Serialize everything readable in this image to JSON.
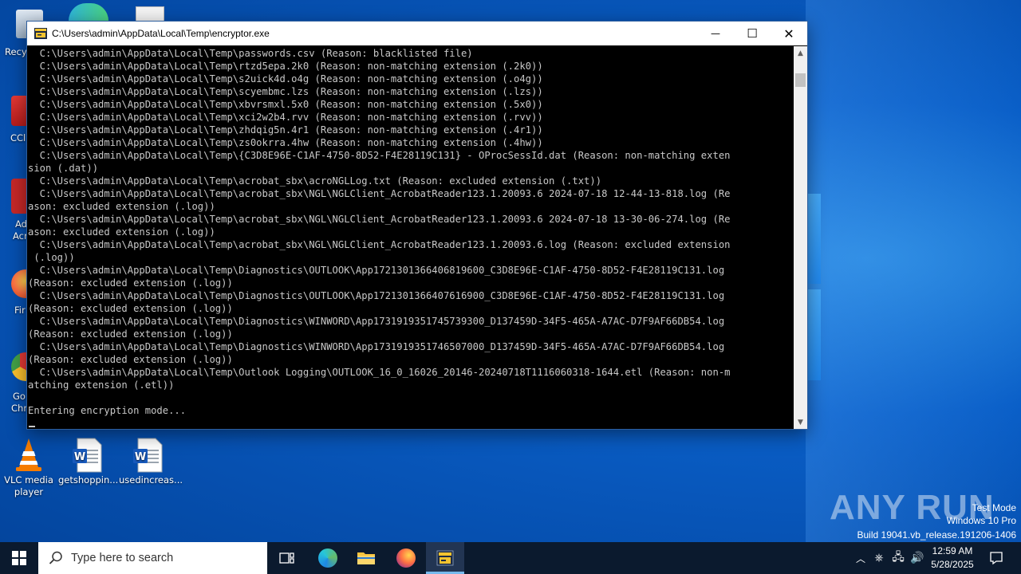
{
  "window": {
    "title": "C:\\Users\\admin\\AppData\\Local\\Temp\\encryptor.exe",
    "controls": {
      "minimize": "—",
      "maximize": "☐",
      "close": "✕"
    }
  },
  "console": {
    "lines": [
      "  C:\\Users\\admin\\AppData\\Local\\Temp\\passwords.csv (Reason: blacklisted file)",
      "  C:\\Users\\admin\\AppData\\Local\\Temp\\rtzd5epa.2k0 (Reason: non-matching extension (.2k0))",
      "  C:\\Users\\admin\\AppData\\Local\\Temp\\s2uick4d.o4g (Reason: non-matching extension (.o4g))",
      "  C:\\Users\\admin\\AppData\\Local\\Temp\\scyembmc.lzs (Reason: non-matching extension (.lzs))",
      "  C:\\Users\\admin\\AppData\\Local\\Temp\\xbvrsmxl.5x0 (Reason: non-matching extension (.5x0))",
      "  C:\\Users\\admin\\AppData\\Local\\Temp\\xci2w2b4.rvv (Reason: non-matching extension (.rvv))",
      "  C:\\Users\\admin\\AppData\\Local\\Temp\\zhdqig5n.4r1 (Reason: non-matching extension (.4r1))",
      "  C:\\Users\\admin\\AppData\\Local\\Temp\\zs0okrra.4hw (Reason: non-matching extension (.4hw))",
      "  C:\\Users\\admin\\AppData\\Local\\Temp\\{C3D8E96E-C1AF-4750-8D52-F4E28119C131} - OProcSessId.dat (Reason: non-matching exten",
      "sion (.dat))",
      "  C:\\Users\\admin\\AppData\\Local\\Temp\\acrobat_sbx\\acroNGLLog.txt (Reason: excluded extension (.txt))",
      "  C:\\Users\\admin\\AppData\\Local\\Temp\\acrobat_sbx\\NGL\\NGLClient_AcrobatReader123.1.20093.6 2024-07-18 12-44-13-818.log (Re",
      "ason: excluded extension (.log))",
      "  C:\\Users\\admin\\AppData\\Local\\Temp\\acrobat_sbx\\NGL\\NGLClient_AcrobatReader123.1.20093.6 2024-07-18 13-30-06-274.log (Re",
      "ason: excluded extension (.log))",
      "  C:\\Users\\admin\\AppData\\Local\\Temp\\acrobat_sbx\\NGL\\NGLClient_AcrobatReader123.1.20093.6.log (Reason: excluded extension",
      " (.log))",
      "  C:\\Users\\admin\\AppData\\Local\\Temp\\Diagnostics\\OUTLOOK\\App1721301366406819600_C3D8E96E-C1AF-4750-8D52-F4E28119C131.log",
      "(Reason: excluded extension (.log))",
      "  C:\\Users\\admin\\AppData\\Local\\Temp\\Diagnostics\\OUTLOOK\\App1721301366407616900_C3D8E96E-C1AF-4750-8D52-F4E28119C131.log",
      "(Reason: excluded extension (.log))",
      "  C:\\Users\\admin\\AppData\\Local\\Temp\\Diagnostics\\WINWORD\\App1731919351745739300_D137459D-34F5-465A-A7AC-D7F9AF66DB54.log",
      "(Reason: excluded extension (.log))",
      "  C:\\Users\\admin\\AppData\\Local\\Temp\\Diagnostics\\WINWORD\\App1731919351746507000_D137459D-34F5-465A-A7AC-D7F9AF66DB54.log",
      "(Reason: excluded extension (.log))",
      "  C:\\Users\\admin\\AppData\\Local\\Temp\\Outlook Logging\\OUTLOOK_16_0_16026_20146-20240718T1116060318-1644.etl (Reason: non-m",
      "atching extension (.etl))",
      "",
      "Entering encryption mode..."
    ]
  },
  "desktop": {
    "icons": [
      {
        "label": "VLC media player",
        "icon": "vlc-cone-icon"
      },
      {
        "label": "getshoppin...",
        "icon": "word-document-icon"
      },
      {
        "label": "usedincreas...",
        "icon": "word-document-icon"
      }
    ],
    "partial_labels": [
      "Recy",
      "CCl",
      "Ad",
      "Acr",
      "Fir",
      "Go",
      "Chr"
    ]
  },
  "watermark": {
    "brand": "ANY RUN",
    "mode": "Test Mode",
    "edition": "Windows 10 Pro",
    "build": "Build 19041.vb_release.191206-1406"
  },
  "taskbar": {
    "search_placeholder": "Type here to search",
    "time": "12:59 AM",
    "date": "5/28/2025"
  },
  "colors": {
    "console_bg": "#000000",
    "console_fg": "#c8c8c8",
    "taskbar_bg": "#0b1a2e",
    "desktop_blue": "#0a5fc8"
  }
}
